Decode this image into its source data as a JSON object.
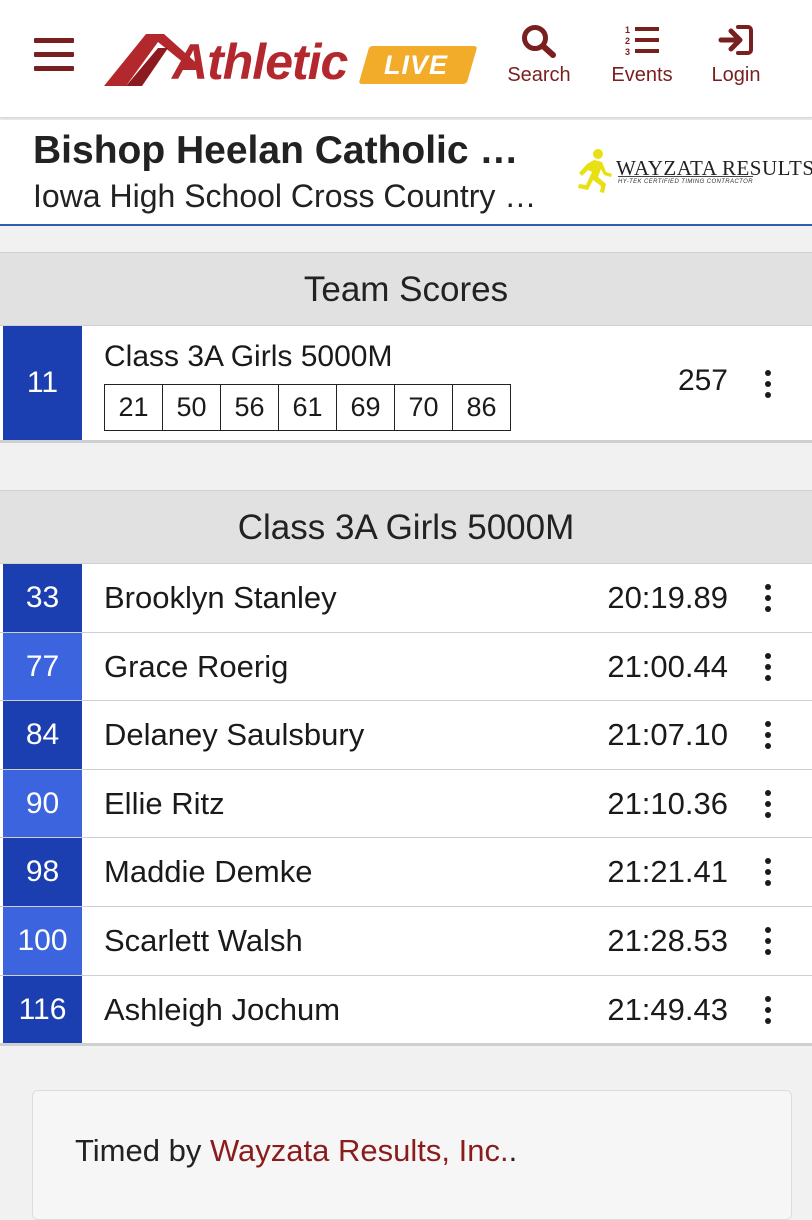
{
  "nav": {
    "logo_main": "Athletic",
    "logo_badge": "LIVE",
    "search_label": "Search",
    "events_label": "Events",
    "login_label": "Login",
    "accent_color": "#7a1f1f"
  },
  "meet": {
    "title": "Bishop Heelan Catholic …",
    "subtitle": "Iowa High School Cross Country …",
    "timer_logo_name": "WAYZATA RESULTS",
    "timer_logo_tag": "HY-TEK CERTIFIED TIMING CONTRACTOR"
  },
  "team_scores": {
    "heading": "Team Scores",
    "place": "11",
    "event": "Class 3A Girls 5000M",
    "scorers": [
      "21",
      "50",
      "56",
      "61",
      "69",
      "70",
      "86"
    ],
    "points": "257"
  },
  "results": {
    "heading": "Class 3A Girls 5000M",
    "athletes": [
      {
        "place": "33",
        "name": "Brooklyn Stanley",
        "time": "20:19.89"
      },
      {
        "place": "77",
        "name": "Grace Roerig",
        "time": "21:00.44"
      },
      {
        "place": "84",
        "name": "Delaney Saulsbury",
        "time": "21:07.10"
      },
      {
        "place": "90",
        "name": "Ellie Ritz",
        "time": "21:10.36"
      },
      {
        "place": "98",
        "name": "Maddie Demke",
        "time": "21:21.41"
      },
      {
        "place": "100",
        "name": "Scarlett Walsh",
        "time": "21:28.53"
      },
      {
        "place": "116",
        "name": "Ashleigh Jochum",
        "time": "21:49.43"
      }
    ]
  },
  "footer": {
    "prefix": "Timed by ",
    "link": "Wayzata Results, Inc.",
    "suffix": "."
  },
  "colors": {
    "place_dark": "#1b3fb0",
    "place_light": "#3b64de",
    "header_border": "#2f5fb3"
  }
}
